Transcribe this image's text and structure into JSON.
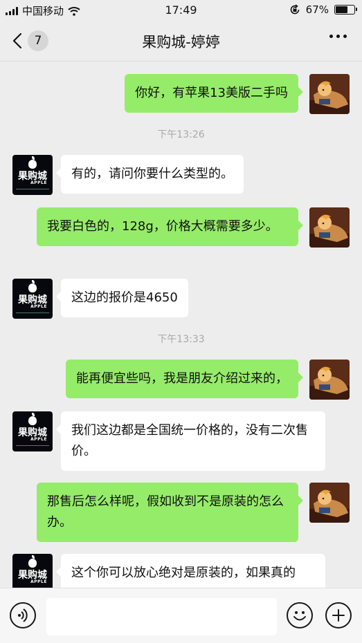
{
  "status_bar": {
    "carrier": "中国移动",
    "time": "17:49",
    "battery_text": "67%",
    "battery_level": 0.67,
    "icons": [
      "signal-icon",
      "wifi-icon",
      "orientation-lock-icon",
      "battery-icon"
    ]
  },
  "nav": {
    "back_badge": "7",
    "title": "果购城-婷婷",
    "icons": [
      "back-chevron-icon",
      "more-dots-icon"
    ]
  },
  "shop_logo": {
    "name": "果购城",
    "sub": "APPLE"
  },
  "messages": [
    {
      "from": "me",
      "text": "你好，有苹果13美版二手吗"
    },
    {
      "type": "time",
      "text": "下午13:26"
    },
    {
      "from": "other",
      "text": "有的，请问你要什么类型的。"
    },
    {
      "from": "me",
      "text": "我要白色的，128g，价格大概需要多少。"
    },
    {
      "from": "other",
      "text": "这边的报价是4650"
    },
    {
      "type": "time",
      "text": "下午13:33"
    },
    {
      "from": "me",
      "text": "能再便宜些吗，我是朋友介绍过来的，"
    },
    {
      "from": "other",
      "text": "我们这边都是全国统一价格的，没有二次售价。"
    },
    {
      "from": "me",
      "text": "那售后怎么样呢，假如收到不是原装的怎么办。"
    },
    {
      "from": "other",
      "text": "这个你可以放心绝对是原装的，如果真的"
    }
  ],
  "input_bar": {
    "field_value": "",
    "icons": [
      "voice-icon",
      "emoji-icon",
      "plus-icon"
    ]
  }
}
